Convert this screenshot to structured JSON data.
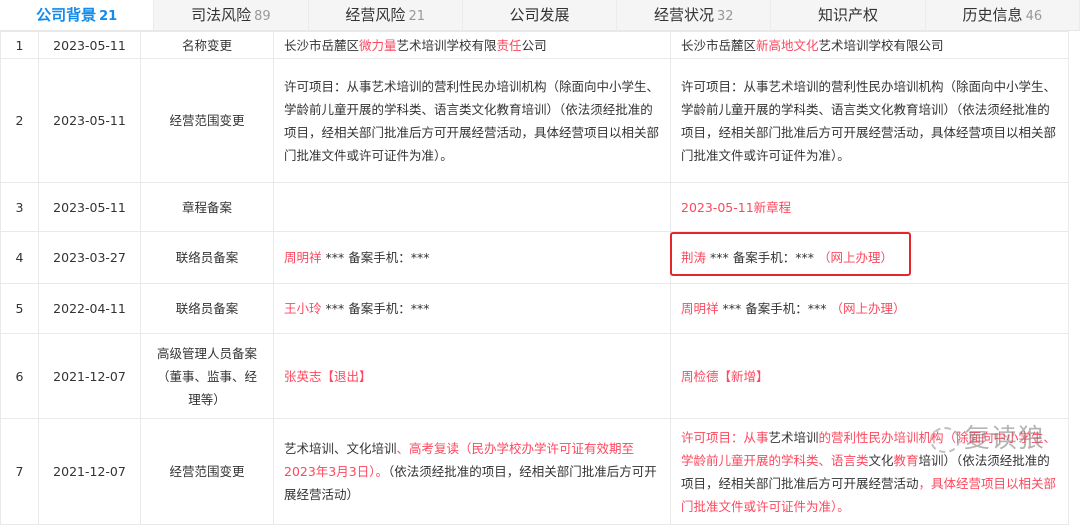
{
  "tabs": [
    {
      "label": "公司背景",
      "count": "21",
      "active": true
    },
    {
      "label": "司法风险",
      "count": "89"
    },
    {
      "label": "经营风险",
      "count": "21"
    },
    {
      "label": "公司发展",
      "count": ""
    },
    {
      "label": "经营状况",
      "count": "32"
    },
    {
      "label": "知识产权",
      "count": ""
    },
    {
      "label": "历史信息",
      "count": "46"
    }
  ],
  "rows": [
    {
      "index": "1",
      "date": "2023-05-11",
      "type": "名称变更",
      "h": 27,
      "before": [
        {
          "t": "长沙市岳麓区"
        },
        {
          "t": "微力量",
          "red": true
        },
        {
          "t": "艺术培训学校有限"
        },
        {
          "t": "责任",
          "red": true
        },
        {
          "t": "公司"
        }
      ],
      "after": [
        {
          "t": "长沙市岳麓区"
        },
        {
          "t": "新高地文化",
          "red": true
        },
        {
          "t": "艺术培训学校有限公司"
        }
      ]
    },
    {
      "index": "2",
      "date": "2023-05-11",
      "type": "经营范围变更",
      "h": 124,
      "before": [
        {
          "t": "许可项目：从事艺术培训的营利性民办培训机构（除面向中小学生、学龄前儿童开展的学科类、语言类文化教育培训）（依法须经批准的项目，经相关部门批准后方可开展经营活动，具体经营项目以相关部门批准文件或许可证件为准）。"
        }
      ],
      "after": [
        {
          "t": "许可项目：从事艺术培训的营利性民办培训机构（除面向中小学生、学龄前儿童开展的学科类、语言类文化教育培训）（依法须经批准的项目，经相关部门批准后方可开展经营活动，具体经营项目以相关部门批准文件或许可证件为准）。"
        }
      ]
    },
    {
      "index": "3",
      "date": "2023-05-11",
      "type": "章程备案",
      "h": 49,
      "before": [],
      "after": [
        {
          "t": "2023-05-11新章程",
          "red": true
        }
      ]
    },
    {
      "index": "4",
      "date": "2023-03-27",
      "type": "联络员备案",
      "h": 52,
      "before": [
        {
          "t": "周明祥",
          "red": true
        },
        {
          "t": " *** 备案手机：***"
        }
      ],
      "after": [
        {
          "t": "荆涛",
          "red": true
        },
        {
          "t": " *** 备案手机：*** "
        },
        {
          "t": "（网上办理）",
          "red": true
        }
      ]
    },
    {
      "index": "5",
      "date": "2022-04-11",
      "type": "联络员备案",
      "h": 50,
      "before": [
        {
          "t": "王小玲",
          "red": true
        },
        {
          "t": " *** 备案手机：***"
        }
      ],
      "after": [
        {
          "t": "周明祥",
          "red": true
        },
        {
          "t": " *** 备案手机：*** "
        },
        {
          "t": "（网上办理）",
          "red": true
        }
      ]
    },
    {
      "index": "6",
      "date": "2021-12-07",
      "type": "高级管理人员备案（董事、监事、经理等）",
      "h": 85,
      "before": [
        {
          "t": "张英志【退出】",
          "red": true
        }
      ],
      "after": [
        {
          "t": "周检德【新增】",
          "red": true
        }
      ]
    },
    {
      "index": "7",
      "date": "2021-12-07",
      "type": "经营范围变更",
      "h": 106,
      "before": [
        {
          "t": "艺术培训、文化培训"
        },
        {
          "t": "、高考复读（民办学校办学许可证有效期至2023年3月3日）。",
          "red": true
        },
        {
          "t": "（依法须经批准的项目，经相关部门批准后方可开展经营活动）"
        }
      ],
      "after": [
        {
          "t": "许可项目：从事",
          "red": true
        },
        {
          "t": "艺术培训"
        },
        {
          "t": "的营利性民办培训机构（除面向中小学生、学龄前儿童开展的学科类、语言类",
          "red": true
        },
        {
          "t": "文化"
        },
        {
          "t": "教育",
          "red": true
        },
        {
          "t": "培训）（依法须经批准的项目，经相关部门批准后方可开展经营活动"
        },
        {
          "t": "，具体经营项目以相关部门批准文件或许可证件为准）。",
          "red": true
        }
      ]
    }
  ],
  "watermark": "复读狼"
}
